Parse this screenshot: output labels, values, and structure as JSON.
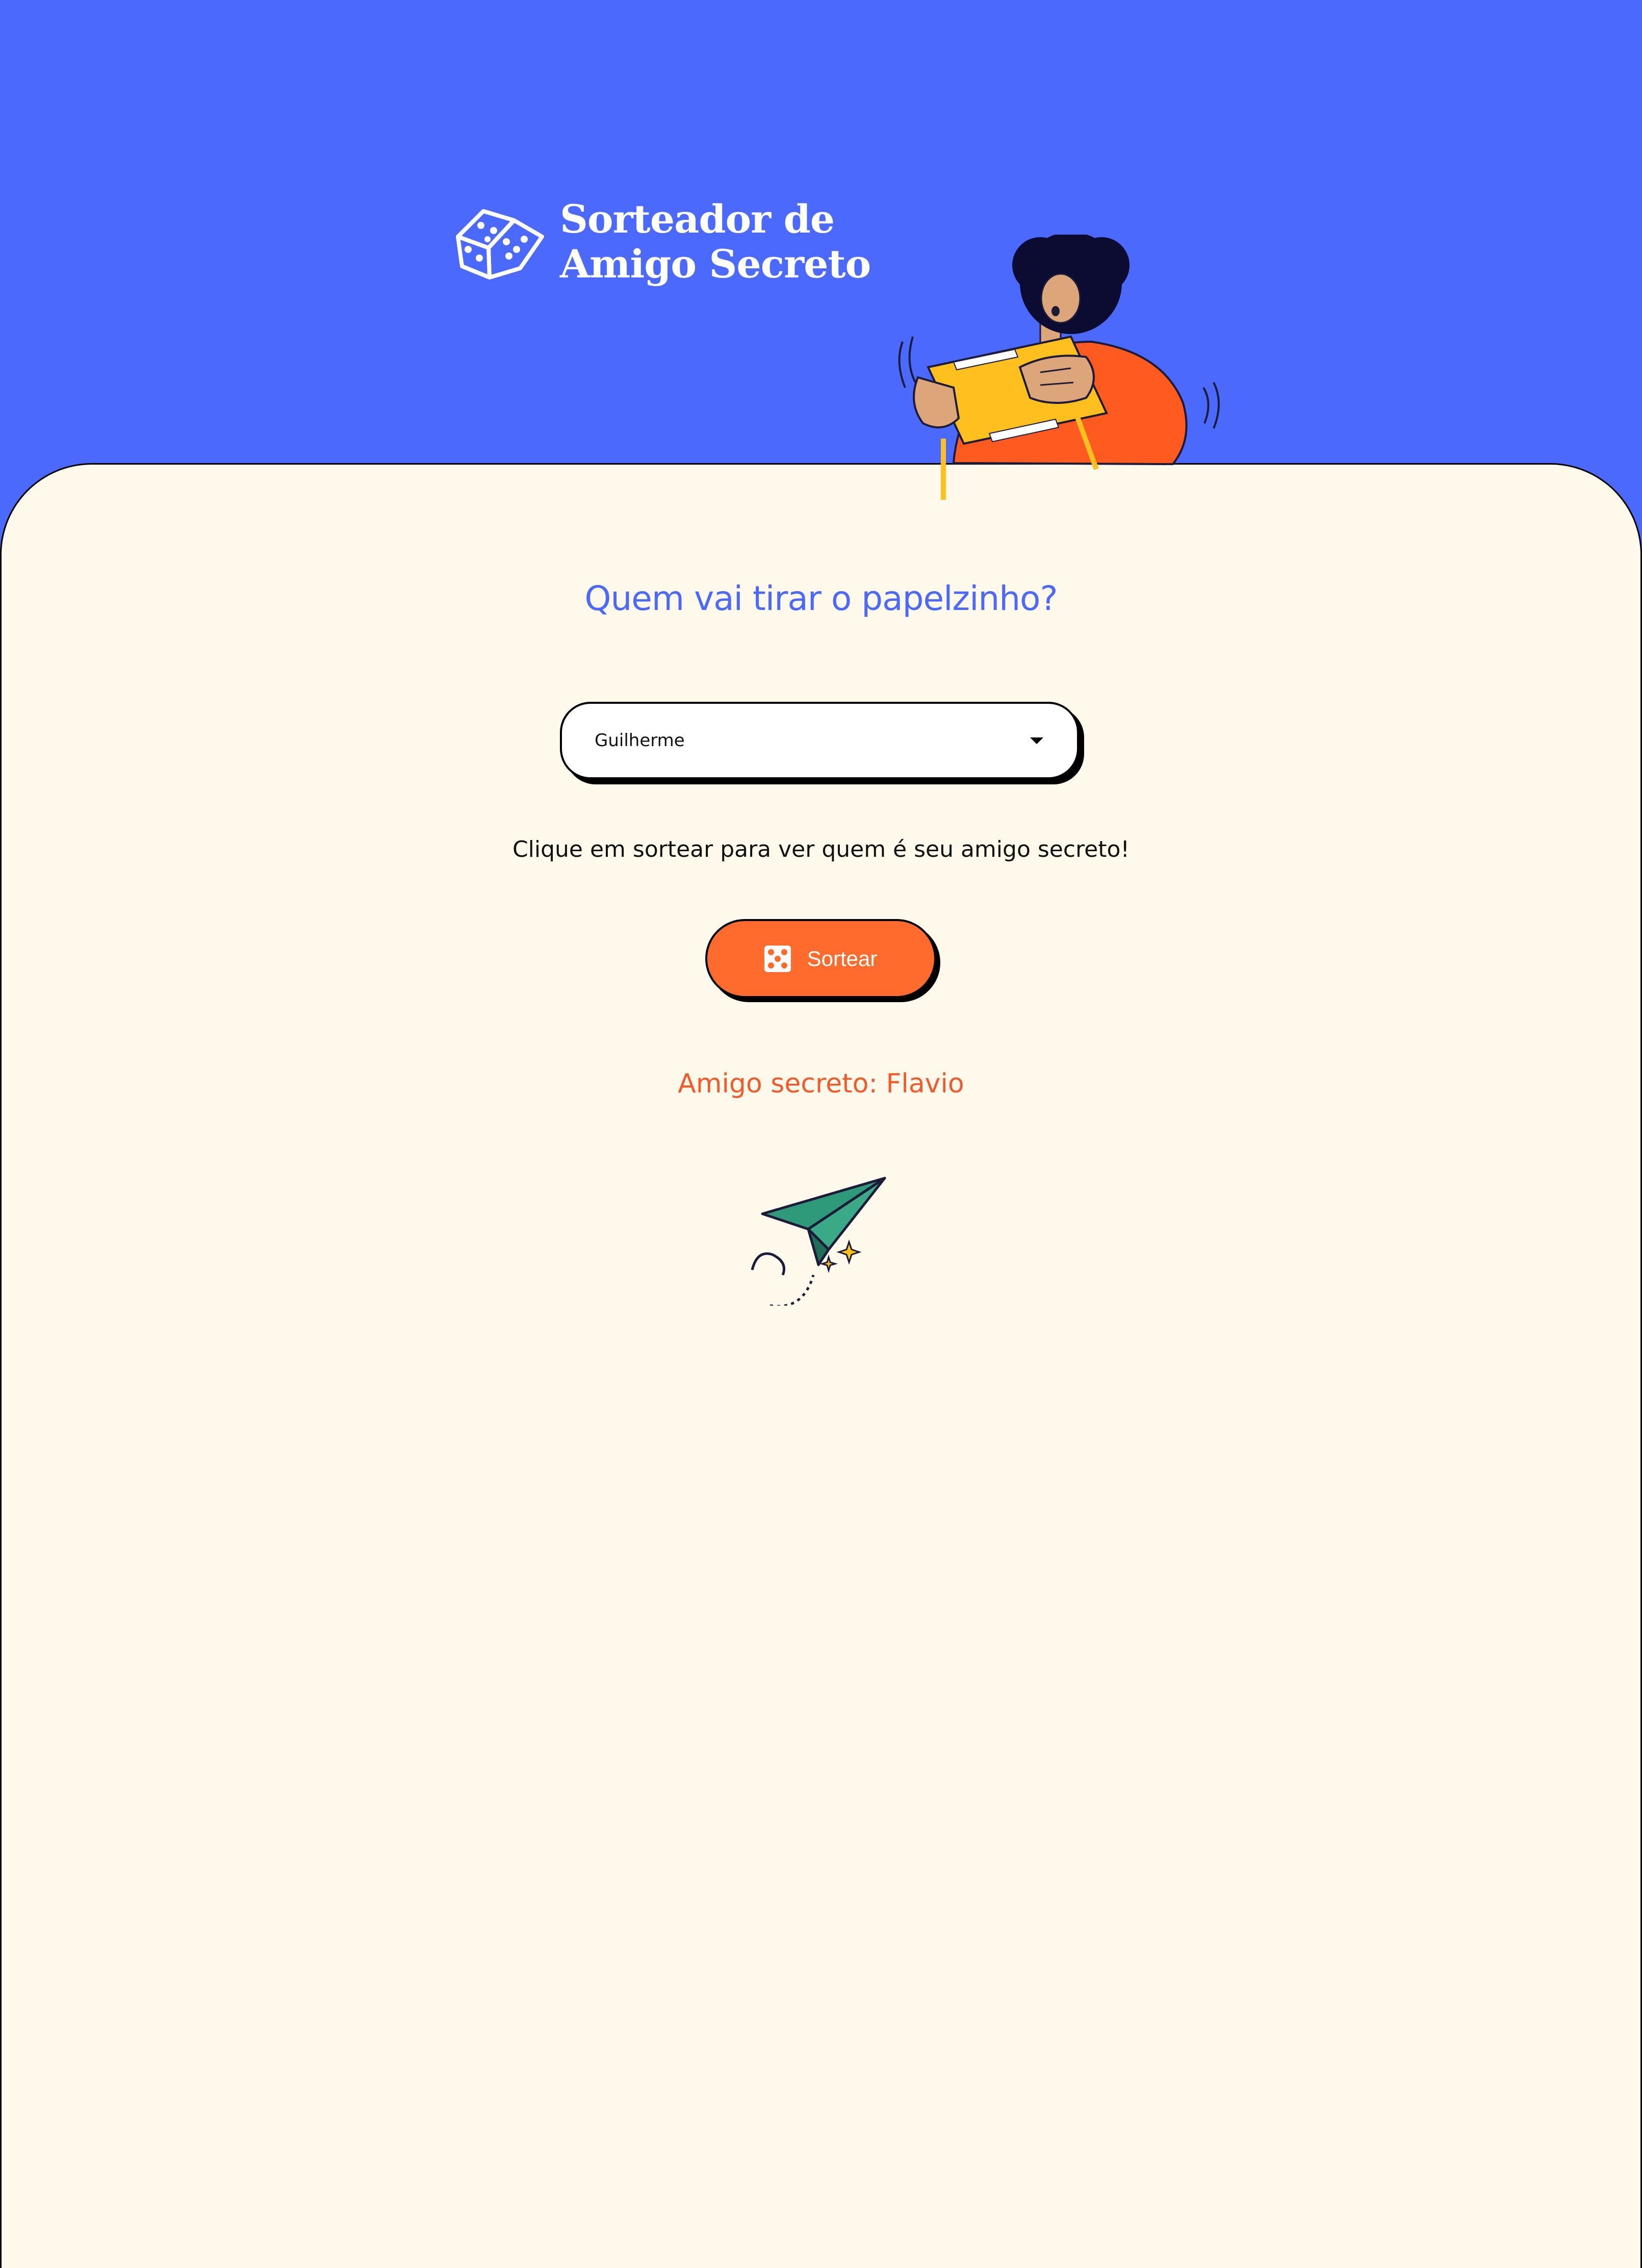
{
  "header": {
    "logo_line1": "Sorteador de",
    "logo_line2": "Amigo Secreto",
    "logo_icon": "dice-icon",
    "hero_illustration": "person-shaking-gift-box-illustration"
  },
  "main": {
    "title": "Quem vai tirar o papelzinho?",
    "participant_select": {
      "value": "Guilherme"
    },
    "hint": "Clique em sortear para ver quem é seu amigo secreto!",
    "draw_button": {
      "label": "Sortear",
      "icon": "dice-icon"
    },
    "result": "Amigo secreto: Flavio",
    "footer_illustration": "paper-plane-icon"
  },
  "colors": {
    "header_bg": "#4b69fd",
    "page_bg": "#fff9eb",
    "accent_orange": "#ff6b2c",
    "title_blue": "#4b69fd",
    "plane_green": "#2e9a7a"
  }
}
